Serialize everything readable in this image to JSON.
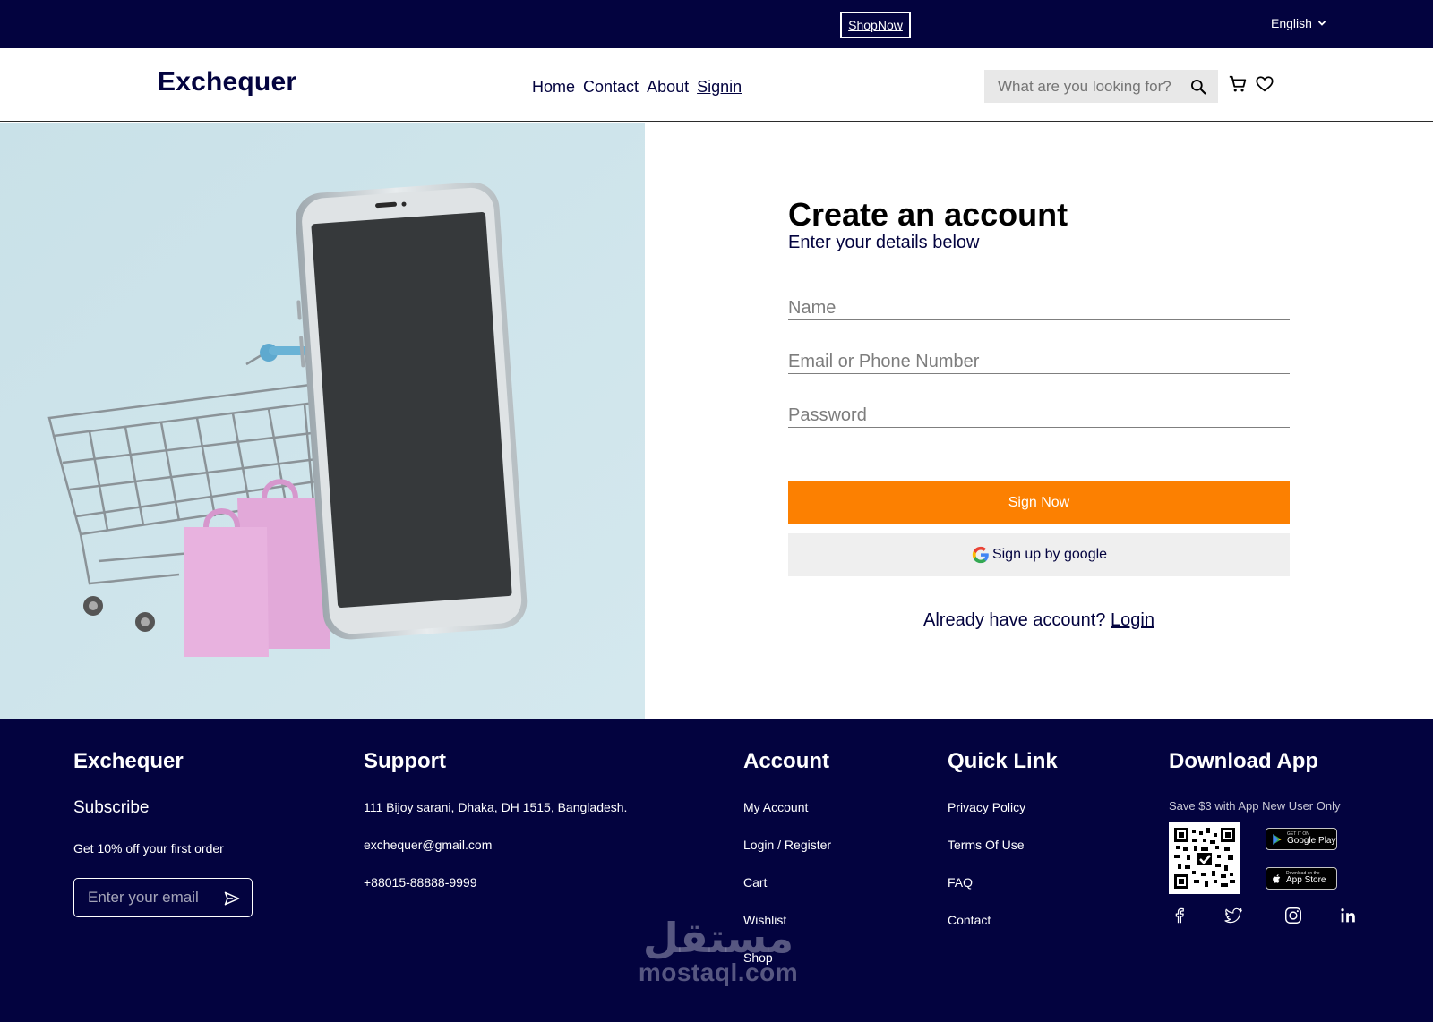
{
  "topbar": {
    "shop_now": "ShopNow",
    "language": "English"
  },
  "header": {
    "logo": "Exchequer",
    "nav": [
      "Home",
      "Contact",
      "About",
      "Signin"
    ],
    "search_placeholder": "What are you looking for?"
  },
  "form": {
    "title": "Create an account",
    "subtitle": "Enter your details below",
    "name_placeholder": "Name",
    "email_placeholder": "Email or Phone Number",
    "password_placeholder": "Password",
    "sign_button": "Sign Now",
    "google_button": "Sign up by google",
    "already": "Already have account?",
    "login": "Login"
  },
  "footer": {
    "brand": {
      "title": "Exchequer",
      "subscribe": "Subscribe",
      "offer": "Get 10% off your first order",
      "email_placeholder": "Enter your email"
    },
    "support": {
      "title": "Support",
      "address": "111 Bijoy sarani, Dhaka, DH 1515, Bangladesh.",
      "email": "exchequer@gmail.com",
      "phone": "+88015-88888-9999"
    },
    "account": {
      "title": "Account",
      "links": [
        "My Account",
        "Login / Register",
        "Cart",
        "Wishlist",
        "Shop"
      ]
    },
    "quick": {
      "title": "Quick Link",
      "links": [
        "Privacy Policy",
        "Terms Of Use",
        "FAQ",
        "Contact"
      ]
    },
    "app": {
      "title": "Download App",
      "promo": "Save $3 with App New User Only",
      "google_play_small": "GET IT ON",
      "google_play": "Google Play",
      "app_store_small": "Download on the",
      "app_store": "App Store"
    },
    "social_icons": [
      "facebook-icon",
      "twitter-icon",
      "instagram-icon",
      "linkedin-icon"
    ],
    "watermark_ar": "مستقل",
    "watermark_en": "mostaql.com"
  },
  "colors": {
    "navy": "#03033f",
    "orange": "#fc8001",
    "google_bg": "#efefef",
    "hero_bg": "#c9e1e8"
  }
}
